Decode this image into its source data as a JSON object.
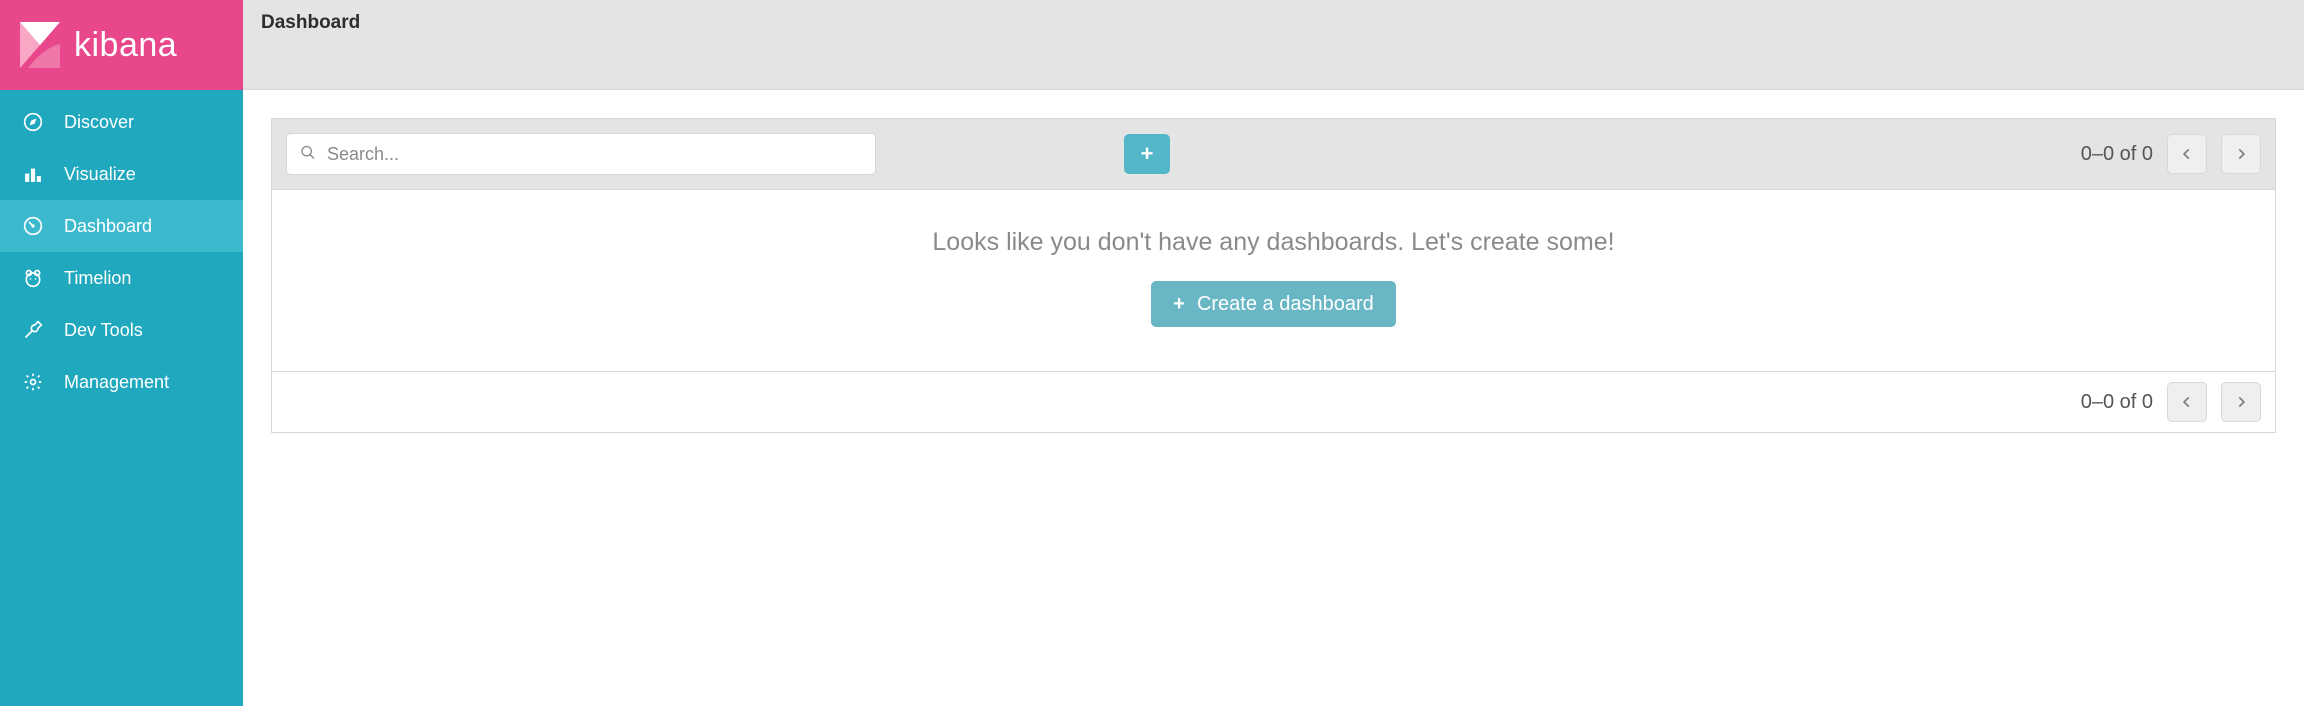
{
  "brand": {
    "label": "kibana"
  },
  "sidebar": {
    "items": [
      {
        "label": "Discover",
        "icon": "compass-icon",
        "active": false
      },
      {
        "label": "Visualize",
        "icon": "barchart-icon",
        "active": false
      },
      {
        "label": "Dashboard",
        "icon": "gauge-icon",
        "active": true
      },
      {
        "label": "Timelion",
        "icon": "bear-icon",
        "active": false
      },
      {
        "label": "Dev Tools",
        "icon": "wrench-icon",
        "active": false
      },
      {
        "label": "Management",
        "icon": "gear-icon",
        "active": false
      }
    ]
  },
  "header": {
    "title": "Dashboard"
  },
  "search": {
    "placeholder": "Search...",
    "value": ""
  },
  "add_button": {
    "glyph": "+"
  },
  "pagination_top": {
    "text": "0–0 of 0"
  },
  "pagination_bottom": {
    "text": "0–0 of 0"
  },
  "empty_state": {
    "message": "Looks like you don't have any dashboards. Let's create some!",
    "create_label": "Create a dashboard"
  },
  "colors": {
    "brand_pink": "#e8488b",
    "sidebar_teal": "#20a8bf",
    "sidebar_teal_active": "#3db9ce",
    "accent_teal": "#54b6c9",
    "chrome_bg": "#e4e4e4"
  }
}
